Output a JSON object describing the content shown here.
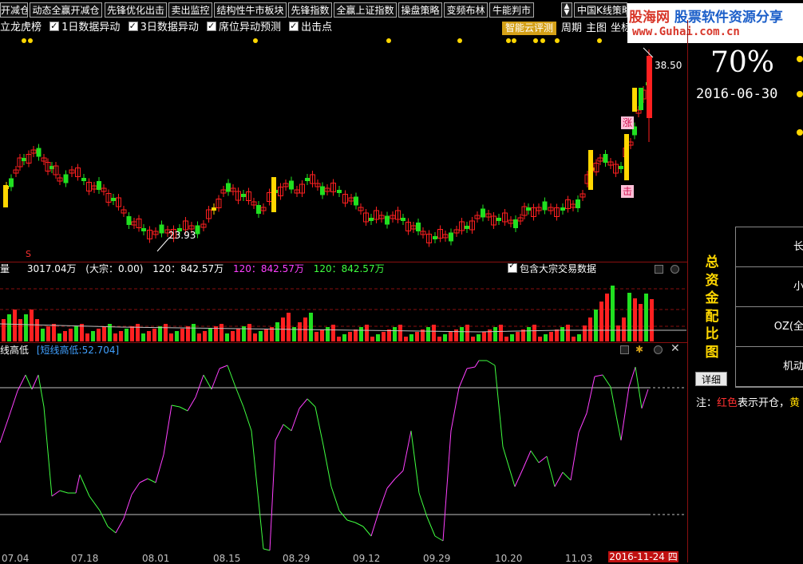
{
  "toolbar": {
    "buttons": [
      "开减仓",
      "动态全赢开减仓",
      "先锋优化出击",
      "卖出监控",
      "结构性牛市板块",
      "先锋指数",
      "全赢上证指数",
      "操盘策略",
      "变频布林",
      "牛能判市"
    ],
    "dropdown_label": "中国K线策略"
  },
  "logo": {
    "line1_a": "股海网",
    "line1_b": "股票软件资源分享",
    "line2": "www.Guhai.com.cn"
  },
  "options": {
    "prefix": "立龙虎榜",
    "items": [
      {
        "label": "1日数据异动",
        "checked": true
      },
      {
        "label": "3日数据异动",
        "checked": true
      },
      {
        "label": "席位异动预测",
        "checked": true
      },
      {
        "label": "出击点",
        "checked": true
      }
    ],
    "eval_button": "智能云评测",
    "nav": [
      "周期",
      "主图",
      "坐标"
    ]
  },
  "price_chart": {
    "high_label": "38.50",
    "low_label": "23.93",
    "marker_zhang": "涨",
    "marker_chu": "击",
    "marker_s": "S"
  },
  "volume_header": {
    "title": "量",
    "total": "3017.04万",
    "dazong": "(大宗：0.00)",
    "ma1": "120：842.57万",
    "ma2": "120：842.57万",
    "ma3": "120：842.57万",
    "colors": {
      "ma1": "#ffffff",
      "ma2": "#ff40ff",
      "ma3": "#40ff40"
    },
    "include_label": "包含大宗交易数据",
    "include_checked": true
  },
  "osc_header": {
    "title": "线高低",
    "value_label": "[短线高低:52.704]"
  },
  "right": {
    "percent": "70%",
    "date": "2016-06-30",
    "vert_title": [
      "总",
      "资",
      "金",
      "配",
      "比",
      "图"
    ],
    "table": [
      "长",
      "小",
      "OZ(全",
      "机动"
    ],
    "detail_button": "详细",
    "note_prefix": "注：",
    "note_red": "红色",
    "note_mid": "表示开仓，",
    "note_yellow": "黄"
  },
  "x_axis": {
    "labels": [
      "07.04",
      "07.18",
      "08.01",
      "08.15",
      "08.29",
      "09.12",
      "09.29",
      "10.20",
      "11.03"
    ],
    "current_date": "2016-11-24",
    "current_day": "四"
  },
  "colors": {
    "up": "#ff2020",
    "down": "#20e020",
    "yellow": "#ffd700",
    "osc_up": "#ff40ff",
    "osc_down": "#40ff40"
  }
}
